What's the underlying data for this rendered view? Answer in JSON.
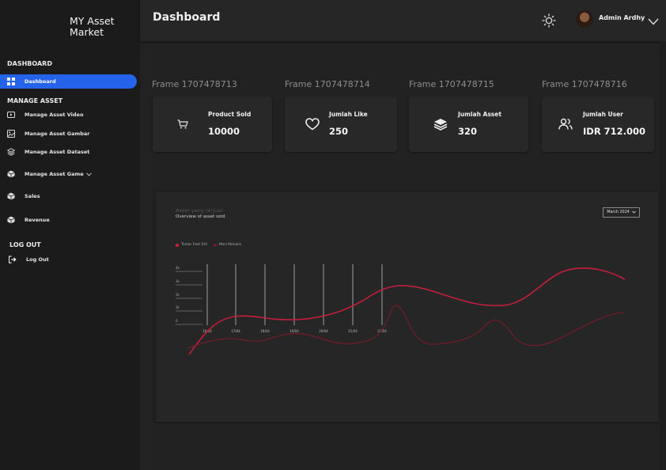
{
  "brand": {
    "line1": "MY Asset",
    "line2": "Market"
  },
  "sidebar": {
    "section_dashboard": "DASHBOARD",
    "section_manage": "MANAGE ASSET",
    "section_logout": "LOG OUT",
    "items": [
      {
        "label": "Dashboard"
      },
      {
        "label": "Manage Asset Video"
      },
      {
        "label": "Manage Asset Gambar"
      },
      {
        "label": "Manage Asset Dataset"
      },
      {
        "label": "Manage Asset Game"
      },
      {
        "label": "Sales"
      },
      {
        "label": "Revenue"
      },
      {
        "label": "Log Out"
      }
    ]
  },
  "header": {
    "title": "Dashboard",
    "user_name": "Admin Ardhy"
  },
  "frames": [
    "Frame 1707478713",
    "Frame 1707478714",
    "Frame 1707478715",
    "Frame 1707478716"
  ],
  "cards": [
    {
      "label": "Product Sold",
      "value": "10000",
      "icon": "cart-icon"
    },
    {
      "label": "Jumlah Like",
      "value": "250",
      "icon": "heart-icon"
    },
    {
      "label": "Jumlah Asset",
      "value": "320",
      "icon": "layers-icon"
    },
    {
      "label": "Jumlah User",
      "value": "IDR 712.000",
      "icon": "users-icon"
    }
  ],
  "chart": {
    "title": "Asset yang terjual",
    "subtitle": "Overview of asset sold",
    "date_button": "March 2024",
    "legend": [
      {
        "name": "Toolar Fest XXI",
        "color": "#c41e3a"
      },
      {
        "name": "Mari Melukis",
        "color": "#6e1e2a"
      }
    ]
  },
  "chart_data": {
    "type": "line",
    "x": [
      "16/04",
      "17/04",
      "18/04",
      "19/04",
      "20/04",
      "21/04",
      "22/04"
    ],
    "y_ticks": [
      "0",
      "1k",
      "2k",
      "3k",
      "4k"
    ],
    "series": [
      {
        "name": "Toolar Fest XXI",
        "color": "#c41e3a"
      },
      {
        "name": "Mari Melukis",
        "color": "#6e1e2a"
      }
    ]
  }
}
